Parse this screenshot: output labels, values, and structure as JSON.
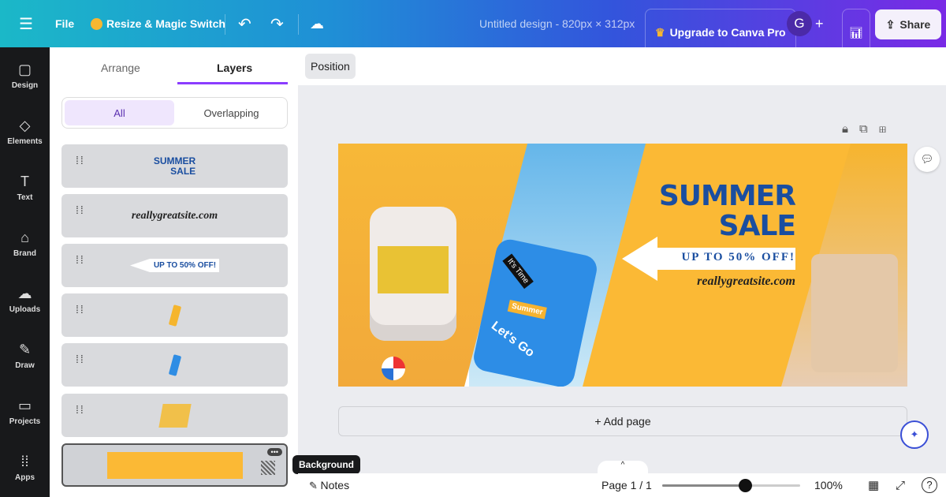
{
  "topbar": {
    "file": "File",
    "resize": "Resize & Magic Switch",
    "title": "Untitled design - 820px × 312px",
    "upgrade": "Upgrade to Canva Pro",
    "avatar": "G",
    "share": "Share"
  },
  "rail": [
    {
      "label": "Design",
      "icon": "▢"
    },
    {
      "label": "Elements",
      "icon": "◇"
    },
    {
      "label": "Text",
      "icon": "T"
    },
    {
      "label": "Brand",
      "icon": "⌂"
    },
    {
      "label": "Uploads",
      "icon": "☁"
    },
    {
      "label": "Draw",
      "icon": "✎"
    },
    {
      "label": "Projects",
      "icon": "▭"
    },
    {
      "label": "Apps",
      "icon": "⁞⁞"
    }
  ],
  "panel": {
    "tabs": [
      "Arrange",
      "Layers"
    ],
    "filters": [
      "All",
      "Overlapping"
    ],
    "layers": [
      {
        "text": "SUMMER\nSALE"
      },
      {
        "text": "reallygreatsite.com"
      },
      {
        "text": "UP TO 50% OFF!"
      },
      {
        "text": ""
      },
      {
        "text": ""
      },
      {
        "text": ""
      },
      {
        "text": ""
      }
    ],
    "tooltip": "Background"
  },
  "toolbar": {
    "position": "Position"
  },
  "design": {
    "title1": "SUMMER",
    "title2": "SALE",
    "offer": "UP TO 50% OFF!",
    "site": "reallygreatsite.com",
    "tag1": "It's Time",
    "tag2": "Summer",
    "tag3": "Let's Go",
    "bg": "#fbb935",
    "accent": "#1a4ea0"
  },
  "add_page": "+ Add page",
  "bottom": {
    "notes": "Notes",
    "page": "Page 1 / 1",
    "zoom": "100%",
    "zoom_level": 0.6
  }
}
